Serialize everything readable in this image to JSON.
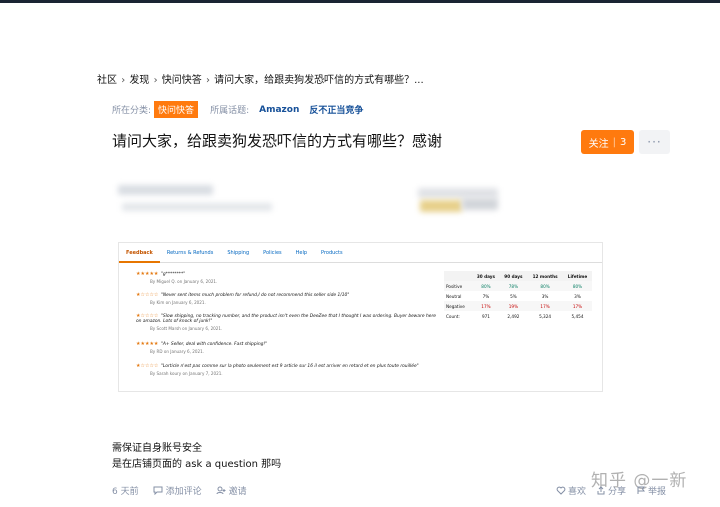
{
  "breadcrumb": {
    "items": [
      "社区",
      "发现",
      "快问快答",
      "请问大家，给跟卖狗发恐吓信的方式有哪些？..."
    ],
    "separator": "›"
  },
  "meta": {
    "category_label": "所在分类:",
    "category_value": "快问快答",
    "topics_label": "所属话题:",
    "topics": [
      "Amazon",
      "反不正当竞争"
    ]
  },
  "question": {
    "title": "请问大家，给跟卖狗发恐吓信的方式有哪些？感谢",
    "follow_label": "关注",
    "follow_count": "3",
    "more_label": "···"
  },
  "screenshot": {
    "tabs": [
      "Feedback",
      "Returns & Refunds",
      "Shipping",
      "Policies",
      "Help",
      "Products"
    ],
    "feedback": [
      {
        "stars": "★★★★★",
        "text": "\"g********\"",
        "by": "By Miguel Q. on January 6, 2021."
      },
      {
        "stars": "★☆☆☆☆",
        "text": "\"Never sent items much problem for refund,I do not recommend this seller side 1/10\"",
        "by": "By Kim on January 6, 2021."
      },
      {
        "stars": "★☆☆☆☆",
        "text": "\"Slow shipping, no tracking number, and the product isn't even the DeeZee that I thought I was ordering. Buyer beware here on amazon. Lots of knock of junk!\"",
        "by": "By Scott Marsh on January 6, 2021."
      },
      {
        "stars": "★★★★★",
        "text": "\"A+ Seller, deal with confidence. Fast shipping!\"",
        "by": "By RD on January 6, 2021."
      },
      {
        "stars": "★☆☆☆☆",
        "text": "\"Lorticle n'est pas comme sur la photo seulement est 9 article sur 16 il est arriver en retard et en plus toute rouillée\"",
        "by": "By Sarah koury on January 7, 2021."
      }
    ],
    "stats": {
      "headers": [
        "",
        "30 days",
        "90 days",
        "12 months",
        "Lifetime"
      ],
      "rows": [
        [
          "Positive",
          "80%",
          "78%",
          "80%",
          "80%"
        ],
        [
          "Neutral",
          "7%",
          "5%",
          "3%",
          "3%"
        ],
        [
          "Negative",
          "17%",
          "19%",
          "17%",
          "17%"
        ],
        [
          "Count:",
          "971",
          "2,492",
          "5,324",
          "5,454"
        ]
      ]
    }
  },
  "content": {
    "line1": "需保证自身账号安全",
    "line2": "是在店铺页面的 ask a question 那吗"
  },
  "footer": {
    "time": "6 天前",
    "comment_label": "添加评论",
    "invite_label": "邀请",
    "like_label": "喜欢",
    "share_label": "分享",
    "report_label": "举报"
  },
  "watermark": "知乎 @一新",
  "colors": {
    "accent": "#ff7a0e",
    "link": "#175199",
    "muted": "#8590a6"
  }
}
